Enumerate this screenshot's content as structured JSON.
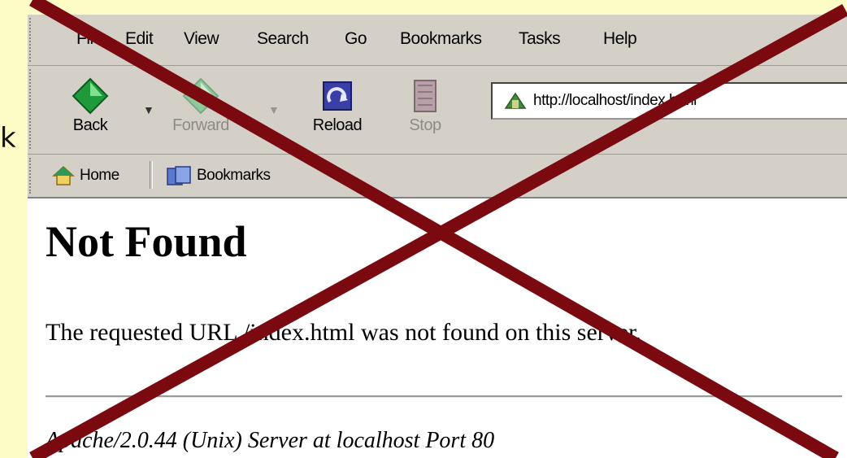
{
  "edge_text": "k",
  "menu": {
    "file": "File",
    "edit": "Edit",
    "view": "View",
    "search": "Search",
    "go": "Go",
    "bookmarks": "Bookmarks",
    "tasks": "Tasks",
    "help": "Help"
  },
  "nav": {
    "back": "Back",
    "forward": "Forward",
    "reload": "Reload",
    "stop": "Stop"
  },
  "url": {
    "value": "http://localhost/index.html"
  },
  "personal_toolbar": {
    "home": "Home",
    "bookmarks": "Bookmarks"
  },
  "page": {
    "heading": "Not Found",
    "message": "The requested URL /index.html was not found on this server.",
    "footer": "Apache/2.0.44 (Unix) Server at localhost Port 80"
  },
  "colors": {
    "slide_background": "#fdfbc6",
    "cross": "#7a0a10",
    "chrome": "#d4d0c8"
  },
  "icons": [
    "back-arrow-icon",
    "forward-arrow-icon",
    "reload-icon",
    "stop-icon",
    "page-icon",
    "home-icon",
    "bookmarks-icon",
    "cross-out-mark"
  ]
}
